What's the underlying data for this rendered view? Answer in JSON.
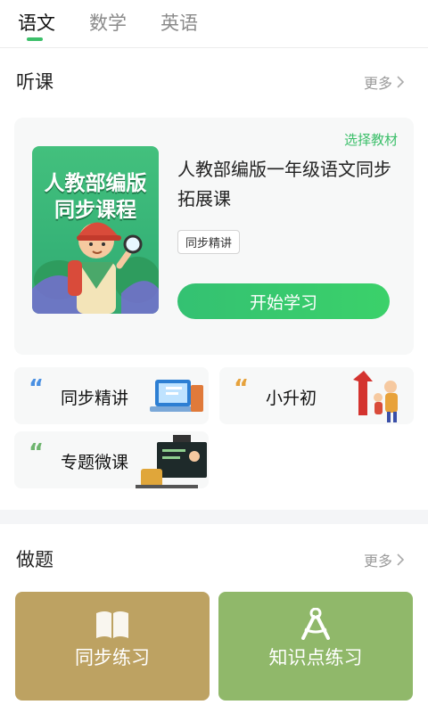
{
  "tabs": [
    {
      "label": "语文",
      "active": true
    },
    {
      "label": "数学",
      "active": false
    },
    {
      "label": "英语",
      "active": false
    }
  ],
  "listen": {
    "title": "听课",
    "more": "更多",
    "select_book": "选择教材",
    "cover_line1": "人教部编版",
    "cover_line2": "同步课程",
    "course_title": "人教部编版一年级语文同步拓展课",
    "tag": "同步精讲",
    "start_button": "开始学习"
  },
  "features": [
    {
      "label": "同步精讲",
      "quote_color": "#4a90e2"
    },
    {
      "label": "小升初",
      "quote_color": "#e6a23c"
    },
    {
      "label": "专题微课",
      "quote_color": "#6fb56f"
    }
  ],
  "practice": {
    "title": "做题",
    "more": "更多",
    "items": [
      {
        "label": "同步练习",
        "icon": "book-icon",
        "color": "#bda262"
      },
      {
        "label": "知识点练习",
        "icon": "compass-icon",
        "color": "#90b86a"
      }
    ]
  },
  "colors": {
    "accent": "#3cbf6a"
  }
}
